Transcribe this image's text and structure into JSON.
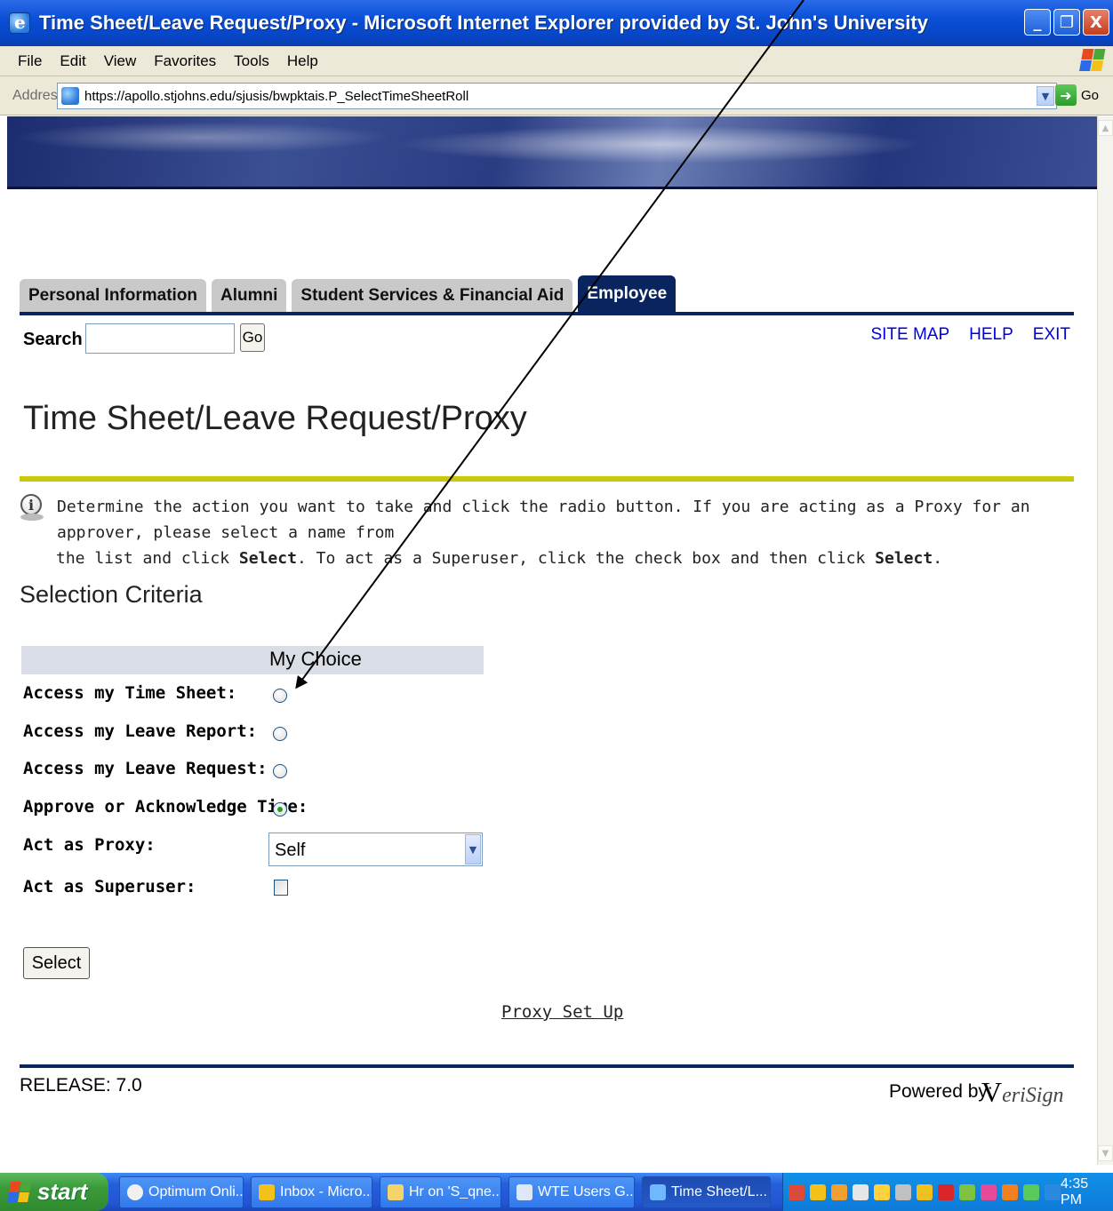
{
  "window": {
    "title": "Time Sheet/Leave Request/Proxy - Microsoft Internet Explorer provided by St. John's University",
    "buttons": {
      "minimize": "_",
      "maximize": "❐",
      "close": "X"
    }
  },
  "menu": [
    "File",
    "Edit",
    "View",
    "Favorites",
    "Tools",
    "Help"
  ],
  "address": {
    "label": "Address",
    "url": "https://apollo.stjohns.edu/sjusis/bwpktais.P_SelectTimeSheetRoll",
    "go_label": "Go"
  },
  "tabs": [
    "Personal Information",
    "Alumni",
    "Student Services & Financial Aid",
    "Employee"
  ],
  "active_tab": "Employee",
  "search": {
    "label": "Search",
    "value": "",
    "go_label": "Go"
  },
  "top_links": [
    "SITE MAP",
    "HELP",
    "EXIT"
  ],
  "page_title": "Time Sheet/Leave Request/Proxy",
  "info": {
    "line1": "Determine the action you want to take and click the radio button. If you are acting as a Proxy for an approver, please select a name from",
    "line2_a": "the list and click ",
    "line2_b": "Select",
    "line2_c": ". To act as a Superuser, click the check box and then click ",
    "line2_d": "Select",
    "line2_e": "."
  },
  "selection": {
    "heading": "Selection Criteria",
    "column_label": "My Choice",
    "rows": [
      {
        "label": "Access my Time Sheet:",
        "checked": false
      },
      {
        "label": "Access my Leave Report:",
        "checked": false
      },
      {
        "label": "Access my Leave Request:",
        "checked": false
      },
      {
        "label": "Approve or Acknowledge Time:",
        "checked": true
      }
    ],
    "proxy_label": "Act as Proxy:",
    "proxy_value": "Self",
    "superuser_label": "Act as Superuser:",
    "superuser_checked": false,
    "select_button": "Select"
  },
  "proxy_setup_link": "Proxy Set Up",
  "footer": {
    "release": "RELEASE: 7.0",
    "powered_by": "Powered by:",
    "brand_v": "V",
    "brand_rest": "eriSign"
  },
  "taskbar": {
    "start_label": "start",
    "tasks": [
      {
        "label": "Optimum Onli...",
        "icon_color": "#f0f0f0",
        "active": false
      },
      {
        "label": "Inbox - Micro...",
        "icon_color": "#f3c21a",
        "active": false
      },
      {
        "label": "Hr on 'S_qne...",
        "icon_color": "#f3d36a",
        "active": false
      },
      {
        "label": "WTE Users G...",
        "icon_color": "#dfe8f8",
        "active": false
      },
      {
        "label": "Time Sheet/L...",
        "icon_color": "#6fb7ff",
        "active": true
      }
    ],
    "clock": "4:35 PM"
  },
  "colors": {
    "tab_active": "#0a2460",
    "accent_rule": "#c9c80c",
    "link": "#0000dd"
  }
}
